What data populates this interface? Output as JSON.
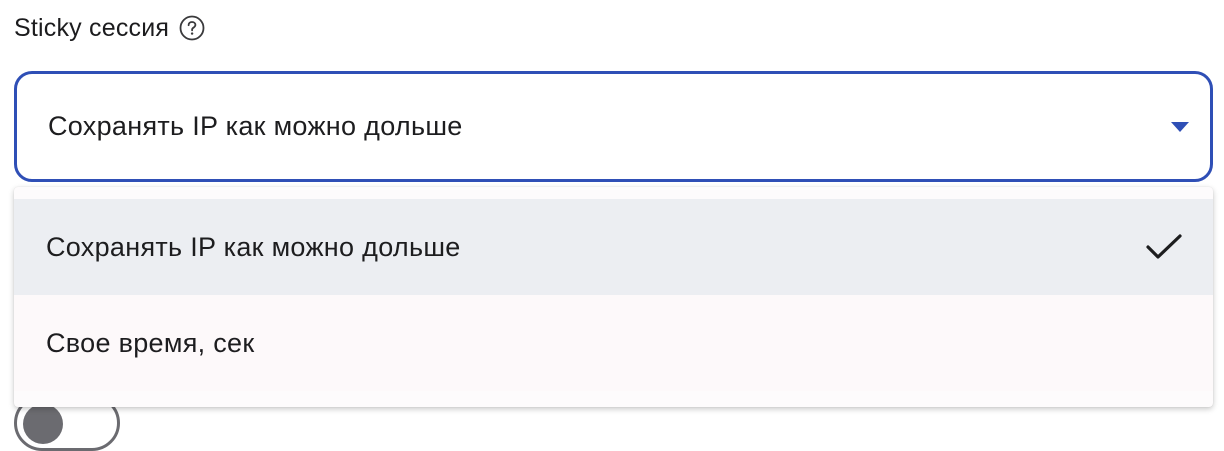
{
  "field": {
    "label": "Sticky сессия",
    "help_icon": "question-circle-icon"
  },
  "select": {
    "value": "Сохранять IP как можно дольше",
    "arrow_icon": "caret-down-icon",
    "accent_color": "#2f4fb6"
  },
  "dropdown": {
    "options": [
      {
        "label": "Сохранять IP как можно дольше",
        "selected": true,
        "icon": "checkmark-icon"
      },
      {
        "label": "Свое время, сек",
        "selected": false
      }
    ],
    "selected_bg": "#eceef2"
  }
}
